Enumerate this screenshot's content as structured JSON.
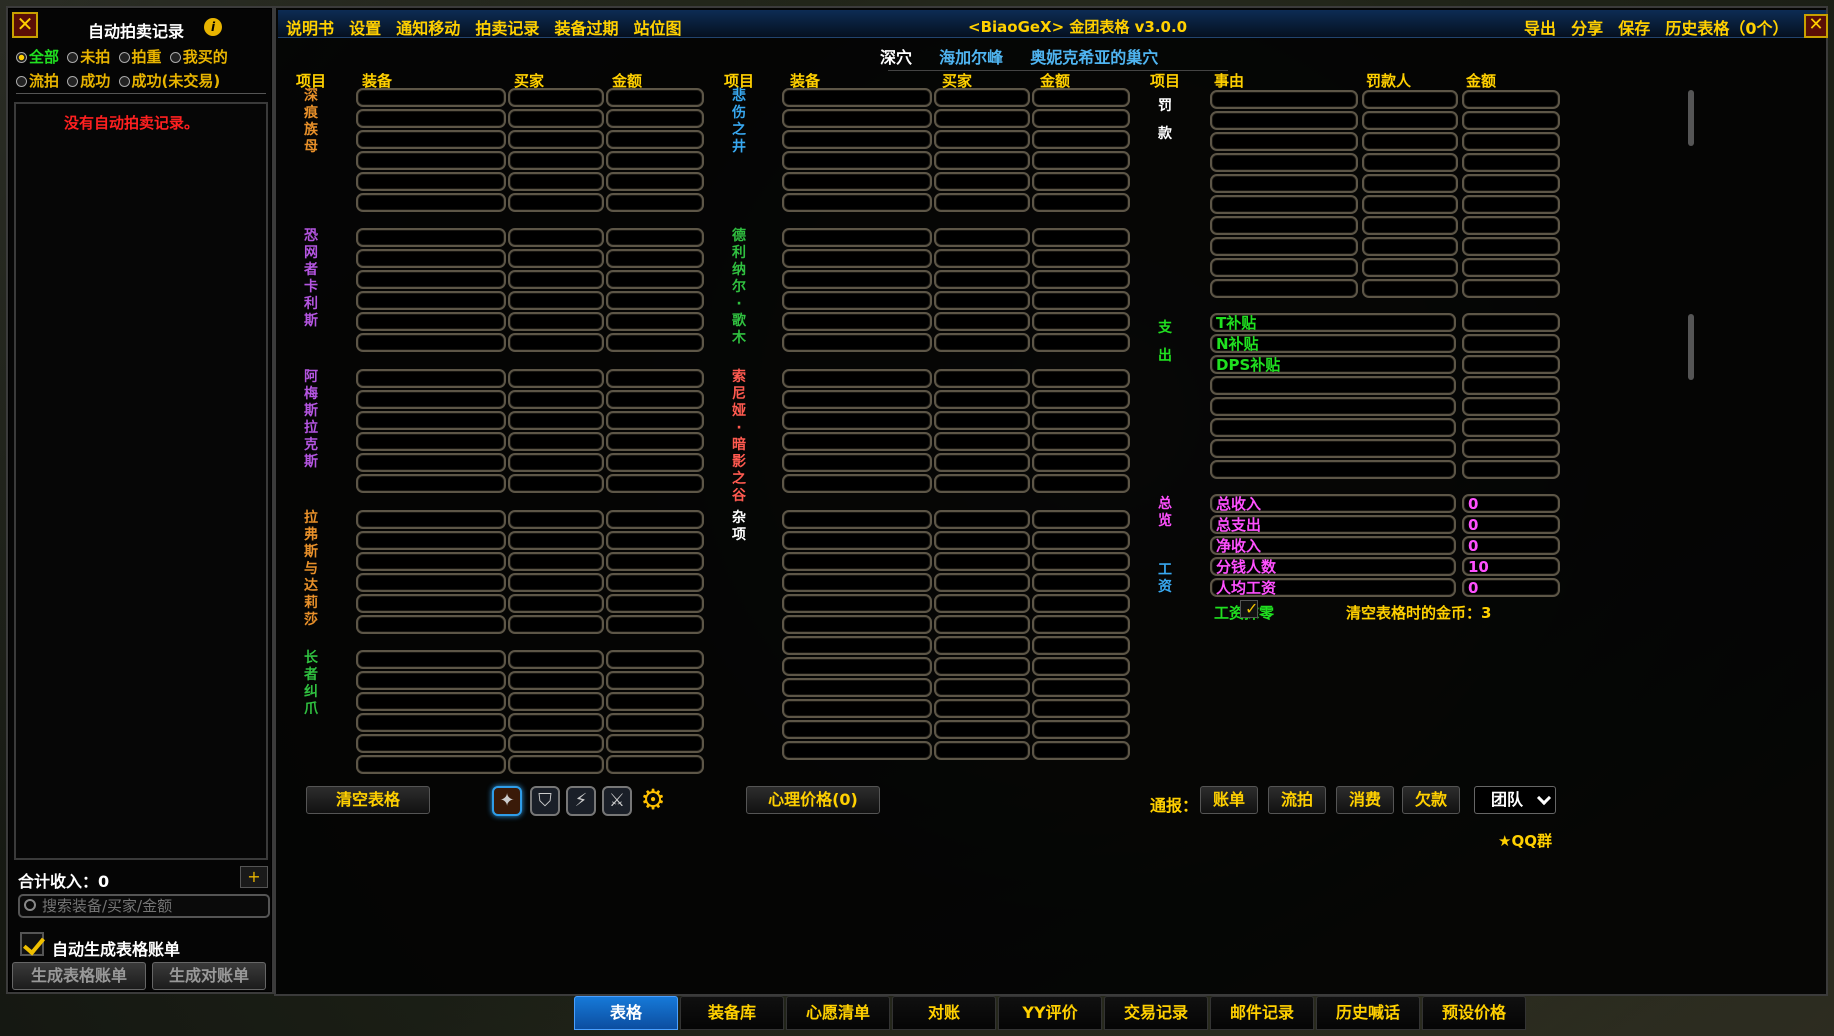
{
  "left_panel": {
    "close": "✕",
    "title": "自动拍卖记录",
    "info": "i",
    "filters_row1": [
      {
        "label": "全部",
        "selected": true
      },
      {
        "label": "未拍",
        "selected": false
      },
      {
        "label": "拍重",
        "selected": false
      },
      {
        "label": "我买的",
        "selected": false
      }
    ],
    "filters_row2": [
      {
        "label": "流拍",
        "selected": false
      },
      {
        "label": "成功",
        "selected": false
      },
      {
        "label": "成功(未交易)",
        "selected": false
      }
    ],
    "empty_message": "没有自动拍卖记录。",
    "total_label": "合计收入：0",
    "add": "+",
    "search_placeholder": "搜索装备/买家/金额",
    "auto_generate_label": "自动生成表格账单",
    "auto_generate_checked": true,
    "gen_table_bill": "生成表格账单",
    "gen_reconcile_bill": "生成对账单"
  },
  "main": {
    "close": "✕",
    "menu": [
      "说明书",
      "设置",
      "通知移动",
      "拍卖记录",
      "装备过期",
      "站位图"
    ],
    "title": "<BiaoGeX> 金团表格 v3.0.0",
    "right_menu": [
      "导出",
      "分享",
      "保存",
      "历史表格（0个）"
    ],
    "raid_tabs": [
      {
        "label": "深穴",
        "active": true
      },
      {
        "label": "海加尔峰",
        "active": false
      },
      {
        "label": "奥妮克希亚的巢穴",
        "active": false
      }
    ],
    "col_headers": {
      "item": "项目",
      "equip": "装备",
      "buyer": "买家",
      "amount": "金额",
      "reason": "事由",
      "fined": "罚款人"
    },
    "bosses_col1": [
      {
        "name": "深痕族母",
        "color": "#e8902a"
      },
      {
        "name": "恐网者卡利斯",
        "color": "#b455e0"
      },
      {
        "name": "阿梅斯拉克斯",
        "color": "#b455e0"
      },
      {
        "name": "拉弗斯与达莉莎",
        "color": "#e8902a"
      },
      {
        "name": "长者纠爪",
        "color": "#30c040"
      }
    ],
    "bosses_col2": [
      {
        "name": "悲伤之井",
        "color": "#38a8f0"
      },
      {
        "name": "德利纳尔·歌木",
        "color": "#30c040"
      },
      {
        "name": "索尼娅·暗影之谷",
        "color": "#ff5a50"
      },
      {
        "name": "杂项",
        "color": "#ffffff"
      }
    ],
    "section_penalty": "罚款",
    "section_expense": "支出",
    "section_summary": "总览",
    "section_salary": "工资",
    "expense_items": [
      "T补贴",
      "N补贴",
      "DPS补贴"
    ],
    "summary_items": [
      {
        "label": "总收入",
        "value": "0"
      },
      {
        "label": "总支出",
        "value": "0"
      },
      {
        "label": "净收入",
        "value": "0"
      },
      {
        "label": "分钱人数",
        "value": "10"
      },
      {
        "label": "人均工资",
        "value": "0"
      }
    ],
    "salary_round_label": "工资抹零",
    "salary_round_checked": true,
    "clear_gold_label": "清空表格时的金币：3",
    "clear_table": "清空表格",
    "mental_price": "心理价格(0)",
    "report_label": "通报：",
    "report_buttons": [
      "账单",
      "流拍",
      "消费",
      "欠款"
    ],
    "team_select": "团队",
    "qq": "QQ群"
  },
  "bottom_tabs": [
    {
      "label": "表格",
      "active": true
    },
    {
      "label": "装备库",
      "active": false
    },
    {
      "label": "心愿清单",
      "active": false
    },
    {
      "label": "对账",
      "active": false
    },
    {
      "label": "YY评价",
      "active": false
    },
    {
      "label": "交易记录",
      "active": false
    },
    {
      "label": "邮件记录",
      "active": false
    },
    {
      "label": "历史喊话",
      "active": false
    },
    {
      "label": "预设价格",
      "active": false
    }
  ]
}
